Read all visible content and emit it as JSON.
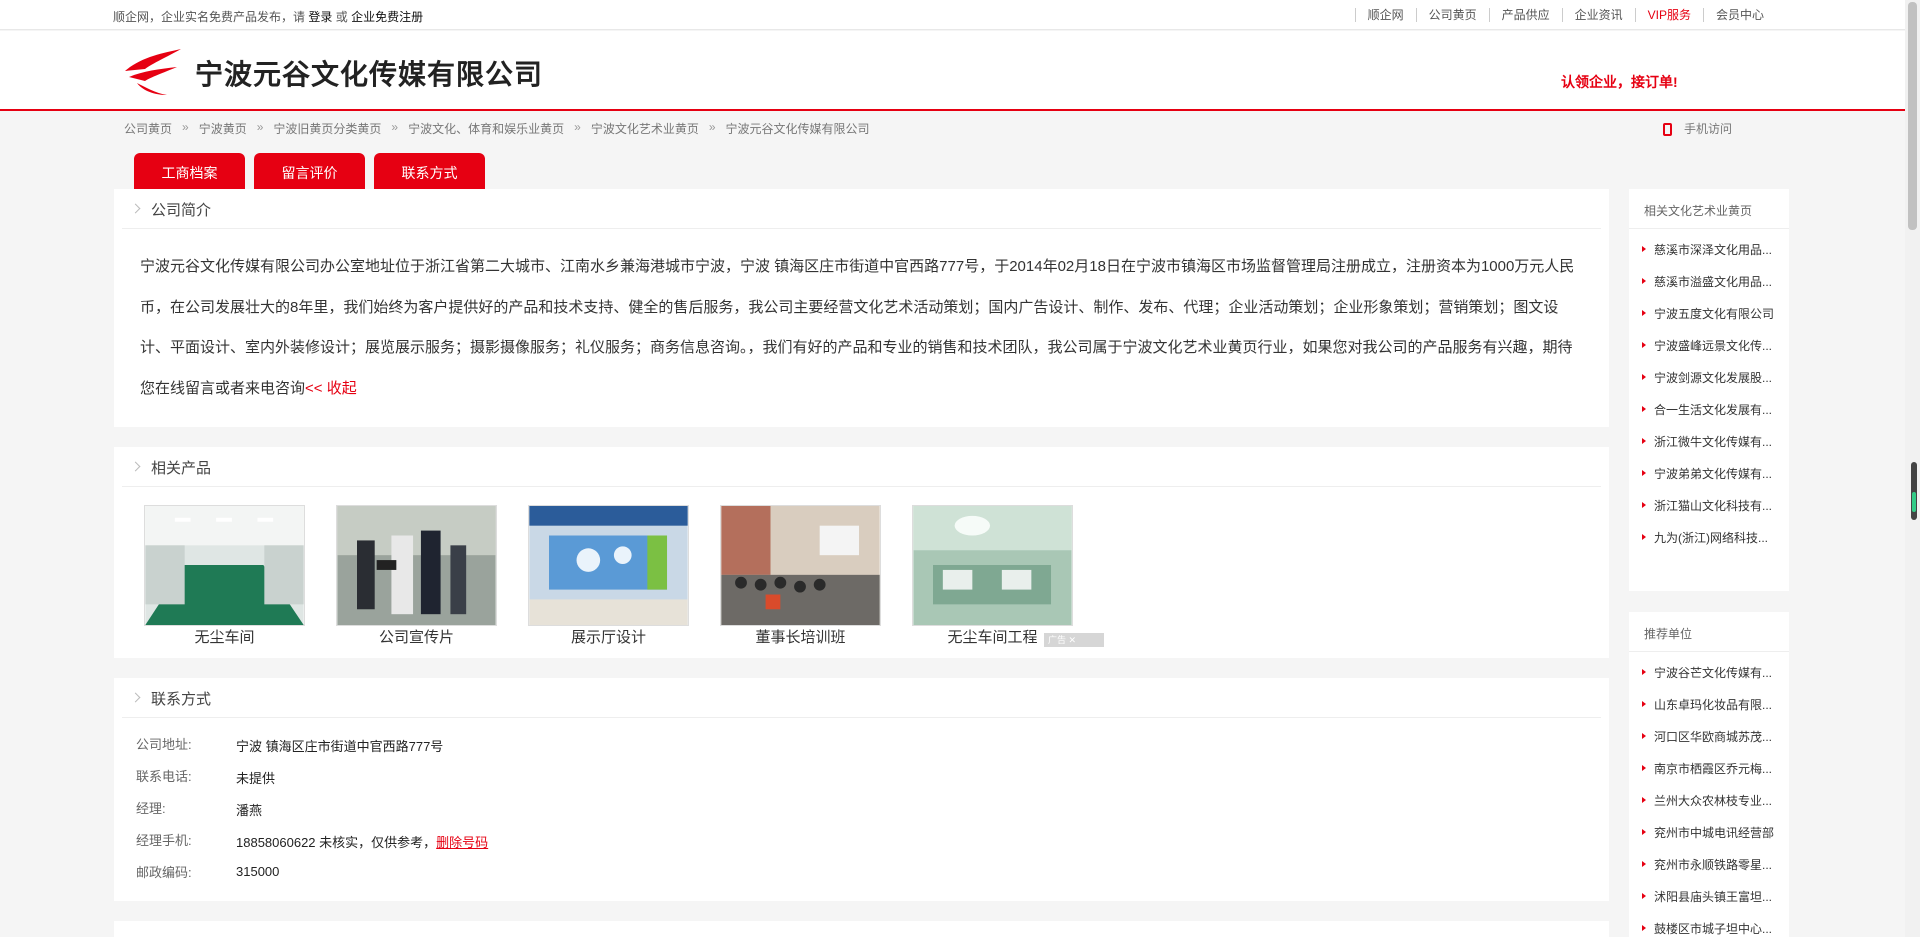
{
  "topbar": {
    "welcome_prefix": "顺企网，企业实名免费产品发布，请",
    "login": "登录",
    "or": "或",
    "register": "企业免费注册",
    "nav": [
      "顺企网",
      "公司黄页",
      "产品供应",
      "企业资讯",
      "VIP服务",
      "会员中心"
    ]
  },
  "header": {
    "company_name": "宁波元谷文化传媒有限公司",
    "claim": "认领企业，接订单!"
  },
  "breadcrumb": [
    "公司黄页",
    "宁波黄页",
    "宁波旧黄页分类黄页",
    "宁波文化、体育和娱乐业黄页",
    "宁波文化艺术业黄页",
    "宁波元谷文化传媒有限公司"
  ],
  "breadcrumb_sep": "»",
  "mobile_link": "手机访问",
  "tabs": [
    "工商档案",
    "留言评价",
    "联系方式"
  ],
  "intro": {
    "title": "公司简介",
    "text": "宁波元谷文化传媒有限公司办公室地址位于浙江省第二大城市、江南水乡兼海港城市宁波，宁波 镇海区庄市街道中官西路777号，于2014年02月18日在宁波市镇海区市场监督管理局注册成立，注册资本为1000万元人民币，在公司发展壮大的8年里，我们始终为客户提供好的产品和技术支持、健全的售后服务，我公司主要经营文化艺术活动策划；国内广告设计、制作、发布、代理；企业活动策划；企业形象策划；营销策划；图文设计、平面设计、室内外装修设计；展览展示服务；摄影摄像服务；礼仪服务；商务信息咨询。，我们有好的产品和专业的销售和技术团队，我公司属于宁波文化艺术业黄页行业，如果您对我公司的产品服务有兴趣，期待您在线留言或者来电咨询",
    "collapse": "<< 收起"
  },
  "products": {
    "title": "相关产品",
    "items": [
      {
        "caption": "无尘车间"
      },
      {
        "caption": "公司宣传片"
      },
      {
        "caption": "展示厅设计"
      },
      {
        "caption": "董事长培训班"
      },
      {
        "caption": "无尘车间工程"
      }
    ],
    "ad_label": "广告"
  },
  "contact": {
    "title": "联系方式",
    "rows": [
      {
        "label": "公司地址:",
        "value": "宁波 镇海区庄市街道中官西路777号"
      },
      {
        "label": "联系电话:",
        "value": "未提供"
      },
      {
        "label": "经理:",
        "value": "潘燕"
      },
      {
        "label": "经理手机:",
        "value": "18858060622 未核实，仅供参考，",
        "link": "删除号码"
      },
      {
        "label": "邮政编码:",
        "value": "315000"
      }
    ]
  },
  "sidebar_related": {
    "title": "相关文化艺术业黄页",
    "items": [
      "慈溪市深泽文化用品...",
      "慈溪市溢盛文化用品...",
      "宁波五度文化有限公司",
      "宁波盛峰远景文化传...",
      "宁波剑源文化发展股...",
      "合一生活文化发展有...",
      "浙江微牛文化传媒有...",
      "宁波弟弟文化传媒有...",
      "浙江猫山文化科技有...",
      "九为(浙江)网络科技..."
    ]
  },
  "sidebar_recommend": {
    "title": "推荐单位",
    "items": [
      "宁波谷芒文化传媒有...",
      "山东卓玛化妆品有限...",
      "河口区华欧商城苏茂...",
      "南京市栖霞区乔元梅...",
      "兰州大众农林枝专业...",
      "兖州市中城电讯经营部",
      "兖州市永顺铁路零星...",
      "沭阳县庙头镇王富坦...",
      "鼓楼区市城子坦中心..."
    ]
  },
  "colors": {
    "brand": "#e60012"
  }
}
